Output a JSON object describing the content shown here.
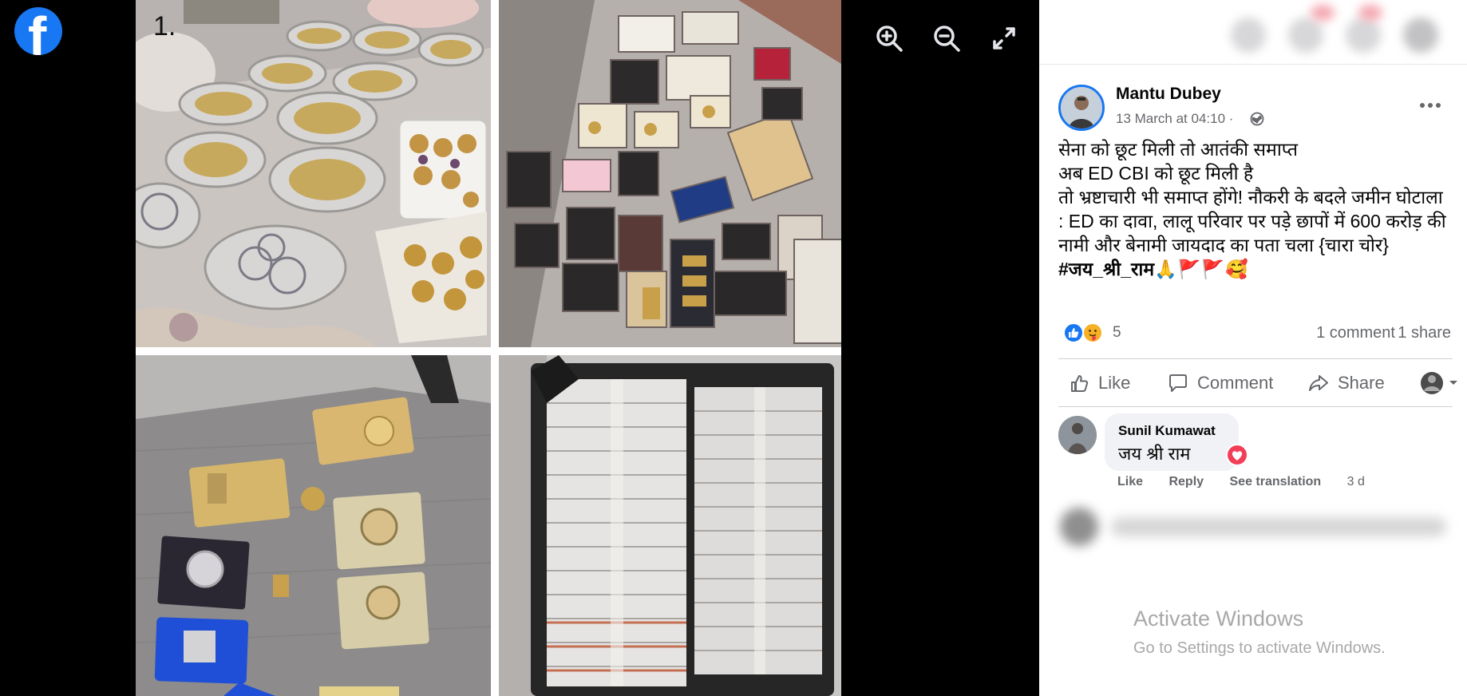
{
  "viewer": {
    "logo_icon": "facebook-logo-icon",
    "collage_label": "1.",
    "controls": [
      {
        "name": "zoom-in-button",
        "icon": "zoom-in-icon"
      },
      {
        "name": "zoom-out-button",
        "icon": "zoom-out-icon"
      },
      {
        "name": "fullscreen-button",
        "icon": "fullscreen-icon"
      }
    ]
  },
  "post": {
    "author": "Mantu Dubey",
    "time": "13 March at 04:10 ·",
    "privacy_icon": "globe-icon",
    "text": "सेना को छूट मिली तो आतंकी समाप्त\nअब ED CBI को छूट मिली है\nतो भ्रष्टाचारी भी समाप्त होंगे! नौकरी के बदले जमीन घोटाला : ED का दावा, लालू परिवार पर पड़े छापों में 600 करोड़ की नामी और बेनामी जायदाद का पता चला {चारा चोर} ",
    "hashtag": "#जय_श्री_राम",
    "emoji": "🙏🚩🚩🥰",
    "reaction_count": "5",
    "comment_count": "1 comment",
    "share_count": "1 share"
  },
  "actions": {
    "like": "Like",
    "comment": "Comment",
    "share": "Share"
  },
  "comment": {
    "author": "Sunil Kumawat",
    "text": "जय श्री राम",
    "like": "Like",
    "reply": "Reply",
    "see_translation": "See translation",
    "timestamp": "3 d"
  },
  "watermark": {
    "title": "Activate Windows",
    "subtitle": "Go to Settings to activate Windows."
  },
  "colors": {
    "facebook_blue": "#1877f2",
    "text_secondary": "#65676b",
    "heart_red": "#f33e58"
  }
}
